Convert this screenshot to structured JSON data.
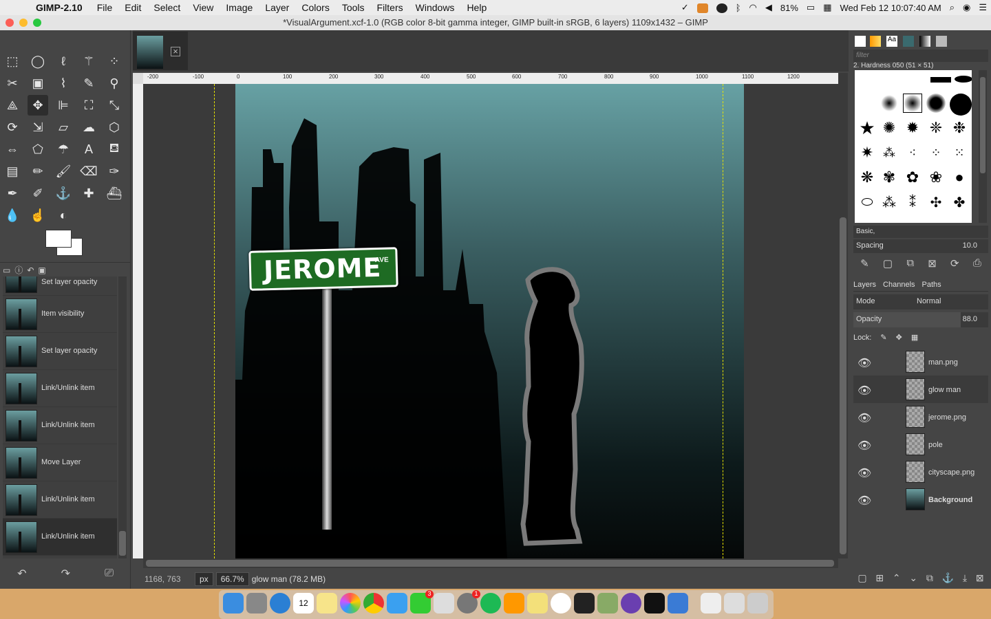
{
  "menubar": {
    "app_name": "GIMP-2.10",
    "items": [
      "File",
      "Edit",
      "Select",
      "View",
      "Image",
      "Layer",
      "Colors",
      "Tools",
      "Filters",
      "Windows",
      "Help"
    ],
    "battery": "81%",
    "datetime": "Wed Feb 12  10:07:40 AM"
  },
  "window": {
    "title": "*VisualArgument.xcf-1.0 (RGB color 8-bit gamma integer, GIMP built-in sRGB, 6 layers) 1109x1432 – GIMP"
  },
  "history": {
    "items": [
      "Set layer opacity",
      "Item visibility",
      "Set layer opacity",
      "Link/Unlink item",
      "Link/Unlink item",
      "Move Layer",
      "Link/Unlink item",
      "Link/Unlink item"
    ]
  },
  "ruler": {
    "ticks": [
      "-200",
      "-100",
      "0",
      "100",
      "200",
      "300",
      "400",
      "500",
      "600",
      "700",
      "800",
      "900",
      "1000",
      "1100",
      "1200"
    ]
  },
  "canvas": {
    "sign_text": "JEROME",
    "sign_suffix": "AVE"
  },
  "status": {
    "coords": "1168, 763",
    "unit": "px",
    "zoom": "66.7%",
    "info": "glow man (78.2 MB)"
  },
  "brushes": {
    "filter_placeholder": "filter",
    "selected_brush": "2. Hardness 050 (51 × 51)",
    "preset": "Basic,",
    "spacing_label": "Spacing",
    "spacing_value": "10.0"
  },
  "layers_panel": {
    "tabs": [
      "Layers",
      "Channels",
      "Paths"
    ],
    "mode_label": "Mode",
    "mode_value": "Normal",
    "opacity_label": "Opacity",
    "opacity_value": "88.0",
    "lock_label": "Lock:",
    "layers": [
      {
        "name": "man.png",
        "selected": false
      },
      {
        "name": "glow man",
        "selected": true
      },
      {
        "name": "jerome.png",
        "selected": false
      },
      {
        "name": "pole",
        "selected": false
      },
      {
        "name": "cityscape.png",
        "selected": false
      },
      {
        "name": "Background",
        "selected": false
      }
    ]
  },
  "dock": {
    "calendar_day": "12",
    "badge_facetime": "3",
    "badge_prefs": "1"
  }
}
